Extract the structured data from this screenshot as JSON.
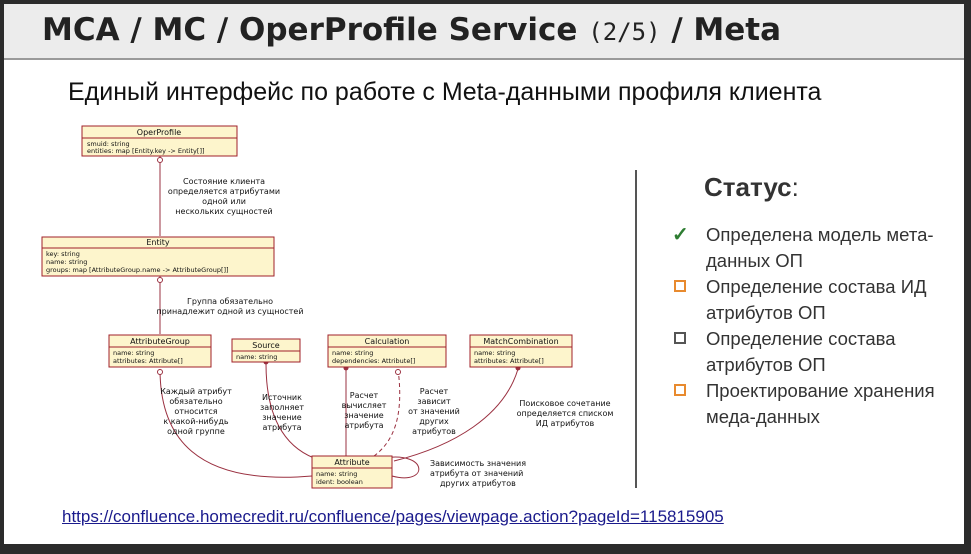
{
  "header": {
    "title_main": "MCA / MC / OperProfile Service",
    "title_count": "(2/5)",
    "title_tail": "/ Meta"
  },
  "subtitle": "Единый интерфейс по работе с Meta-данными профиля клиента",
  "diagram": {
    "classes": {
      "operprofile": {
        "name": "OperProfile",
        "attrs": [
          "smuid: string",
          "entities: map [Entity.key -> Entity[]]"
        ]
      },
      "entity": {
        "name": "Entity",
        "attrs": [
          "key: string",
          "name: string",
          "groups: map [AttributeGroup.name -> AttributeGroup[]]"
        ]
      },
      "attributegroup": {
        "name": "AttributeGroup",
        "attrs": [
          "name: string",
          "attributes: Attribute[]"
        ]
      },
      "source": {
        "name": "Source",
        "attrs": [
          "name: string"
        ]
      },
      "calculation": {
        "name": "Calculation",
        "attrs": [
          "name: string",
          "dependencies: Attribute[]"
        ]
      },
      "matchcombination": {
        "name": "MatchCombination",
        "attrs": [
          "name: string",
          "attributes: Attribute[]"
        ]
      },
      "attribute": {
        "name": "Attribute",
        "attrs": [
          "name: string",
          "ident: boolean"
        ]
      }
    },
    "notes": {
      "op_entity": [
        "Состояние клиента",
        "определяется атрибутами",
        "одной или",
        "нескольких сущностей"
      ],
      "entity_group": [
        "Группа обязательно",
        "принадлежит одной из сущностей"
      ],
      "group_attr": [
        "Каждый атрибут",
        "обязательно",
        "относится",
        "к какой-нибудь",
        "одной группе"
      ],
      "source_attr": [
        "Источник",
        "заполняет",
        "значение",
        "атрибута"
      ],
      "calc_attr1": [
        "Расчет",
        "вычисляет",
        "значение",
        "атрибута"
      ],
      "calc_attr2": [
        "Расчет",
        "зависит",
        "от значений",
        "других",
        "атрибутов"
      ],
      "match_attr": [
        "Поисковое сочетание",
        "определяется списком",
        "ИД атрибутов"
      ],
      "self_attr": [
        "Зависимость значения",
        "атрибута от значений",
        "других атрибутов"
      ]
    }
  },
  "status": {
    "title": "Статус",
    "colon": ":",
    "items": [
      {
        "mark": "check",
        "text": "Определена модель мета-данных ОП"
      },
      {
        "mark": "box-orange",
        "text": "Определение состава ИД атрибутов ОП"
      },
      {
        "mark": "box-gray",
        "text": "Определение состава атрибутов ОП"
      },
      {
        "mark": "box-orange",
        "text": "Проектирование хранения меда-данных"
      }
    ],
    "check_glyph": "✓",
    "colors": {
      "check": "#2e7d32",
      "box_orange": "#e88a2e",
      "box_gray": "#555555",
      "uml_fill": "#fdf5cc",
      "uml_border": "#a0202a",
      "uml_line": "#9a3040"
    }
  },
  "link": "https://confluence.homecredit.ru/confluence/pages/viewpage.action?pageId=115815905"
}
